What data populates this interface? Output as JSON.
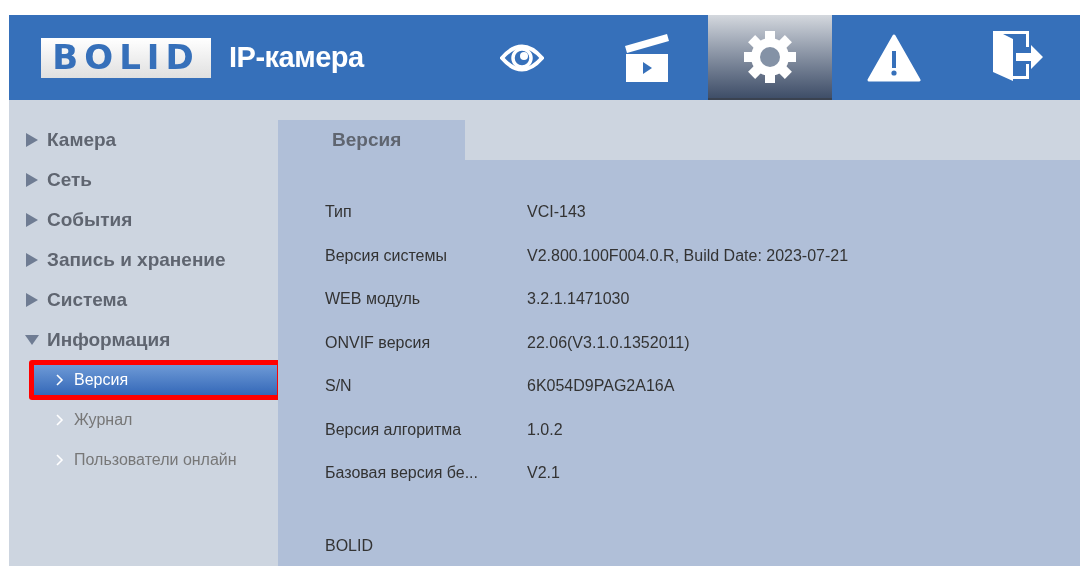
{
  "header": {
    "logo": "BOLID",
    "title": "IP-камера",
    "nav": [
      {
        "kind": "eye",
        "selected": false
      },
      {
        "kind": "clapper",
        "selected": false
      },
      {
        "kind": "gear",
        "selected": true
      },
      {
        "kind": "warning",
        "selected": false
      },
      {
        "kind": "exit",
        "selected": false
      }
    ]
  },
  "sidebar": {
    "items": [
      {
        "label": "Камера",
        "expanded": false
      },
      {
        "label": "Сеть",
        "expanded": false
      },
      {
        "label": "События",
        "expanded": false
      },
      {
        "label": "Запись и хранение",
        "expanded": false
      },
      {
        "label": "Система",
        "expanded": false
      },
      {
        "label": "Информация",
        "expanded": true,
        "children": [
          {
            "label": "Версия",
            "selected": true,
            "highlighted": true
          },
          {
            "label": "Журнал",
            "selected": false,
            "highlighted": false
          },
          {
            "label": "Пользователи онлайн",
            "selected": false,
            "highlighted": false
          }
        ]
      }
    ]
  },
  "tabs": [
    {
      "label": "Версия",
      "selected": true
    }
  ],
  "info": {
    "rows": [
      {
        "label": "Тип",
        "value": "VCI-143"
      },
      {
        "label": "Версия системы",
        "value": "V2.800.100F004.0.R, Build Date: 2023-07-21"
      },
      {
        "label": "WEB модуль",
        "value": "3.2.1.1471030"
      },
      {
        "label": "ONVIF версия",
        "value": "22.06(V3.1.0.1352011)"
      },
      {
        "label": "S/N",
        "value": "6K054D9PAG2A16A"
      },
      {
        "label": "Версия алгоритма",
        "value": "1.0.2"
      },
      {
        "label": "Базовая версия бе...",
        "value": "V2.1"
      }
    ],
    "footer": "BOLID"
  }
}
